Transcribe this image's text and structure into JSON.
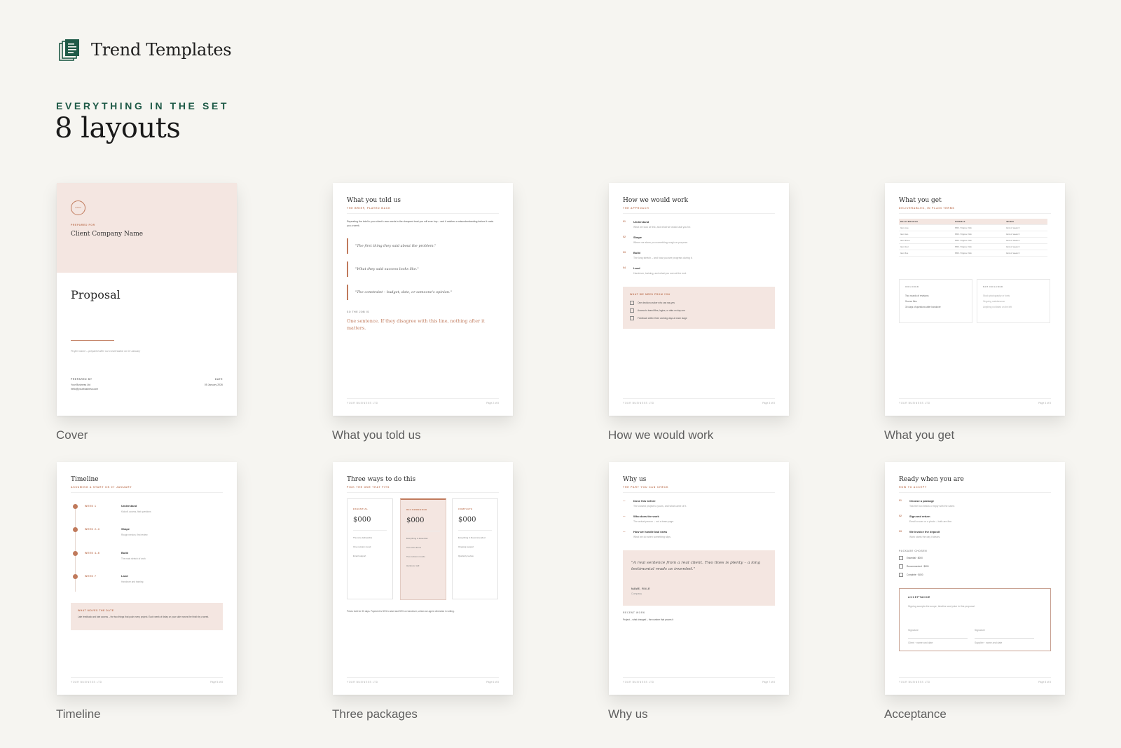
{
  "brand": {
    "name": "Trend Templates",
    "icon": "stacked-document-icon",
    "color": "#1f5a47"
  },
  "section": {
    "eyebrow": "EVERYTHING IN THE SET",
    "title": "8 layouts"
  },
  "colors": {
    "accent": "#c07a5c",
    "blush": "#f4e6e1",
    "brand_green": "#1f5a47",
    "background": "#f6f5f1"
  },
  "layouts": [
    {
      "caption": "Cover",
      "prepared_for_label": "PREPARED FOR",
      "client": "Client Company Name",
      "logo_text": "LOGO",
      "title": "Proposal",
      "project_line": "Project name – prepared after our conversation on 03 January",
      "prepared_by_label": "PREPARED BY",
      "business": "Your Business Ltd",
      "email": "hello@yourbusiness.com",
      "date_label": "DATE",
      "date": "05 January 2026"
    },
    {
      "caption": "What you told us",
      "title": "What you told us",
      "subtitle": "THE BRIEF, PLAYED BACK",
      "intro": "Repeating the brief in your client's own words is the cheapest trust you will ever buy – and it catches a misunderstanding before it costs you a week.",
      "quotes": [
        "\"The first thing they said about the problem.\"",
        "\"What they said success looks like.\"",
        "\"The constraint – budget, date, or someone's opinion.\""
      ],
      "job_label": "SO THE JOB IS",
      "job": "One sentence. If they disagree with this line, nothing after it matters.",
      "footer_left": "YOUR BUSINESS LTD",
      "footer_right": "Page 2 of 8"
    },
    {
      "caption": "How we would work",
      "title": "How we would work",
      "subtitle": "THE APPROACH",
      "steps": [
        {
          "num": "01",
          "name": "Understand",
          "desc": "What we look at first, and what we would ask you for."
        },
        {
          "num": "02",
          "name": "Shape",
          "desc": "Where we show you something rough on purpose."
        },
        {
          "num": "03",
          "name": "Build",
          "desc": "The long stretch – and how you see progress during it."
        },
        {
          "num": "04",
          "name": "Land",
          "desc": "Handover, training, and what you own at the end."
        }
      ],
      "needs_label": "WHAT WE NEED FROM YOU",
      "needs": [
        "One decision-maker who can say yes",
        "Access to brand files, logins, or data on day one",
        "Feedback within three working days at each stage"
      ],
      "footer_left": "YOUR BUSINESS LTD",
      "footer_right": "Page 3 of 8"
    },
    {
      "caption": "What you get",
      "title": "What you get",
      "subtitle": "DELIVERABLES, IN PLAIN TERMS",
      "columns": [
        "DELIVERABLE",
        "FORMAT",
        "WHEN"
      ],
      "rows": [
        [
          "Item one",
          "PDF / Figma / link",
          "End of week 0"
        ],
        [
          "Item two",
          "PDF / Figma / link",
          "End of week 0"
        ],
        [
          "Item three",
          "PDF / Figma / link",
          "End of week 0"
        ],
        [
          "Item four",
          "PDF / Figma / link",
          "End of week 0"
        ],
        [
          "Item five",
          "PDF / Figma / link",
          "End of week 0"
        ]
      ],
      "included_label": "INCLUDED",
      "included": [
        "Two rounds of revisions",
        "Source files",
        "30 days of questions after handover"
      ],
      "not_included_label": "NOT INCLUDED",
      "not_included": [
        "Stock photography or fonts",
        "Ongoing maintenance",
        "Anything not listed on the left"
      ],
      "footer_left": "YOUR BUSINESS LTD",
      "footer_right": "Page 4 of 8"
    },
    {
      "caption": "Timeline",
      "title": "Timeline",
      "subtitle": "ASSUMING A START ON 07 JANUARY",
      "weeks": [
        {
          "week": "WEEK 1",
          "name": "Understand",
          "desc": "Kickoff, access, first questions"
        },
        {
          "week": "WEEK 2–3",
          "name": "Shape",
          "desc": "Rough version, first review"
        },
        {
          "week": "WEEK 4–6",
          "name": "Build",
          "desc": "The main stretch of work"
        },
        {
          "week": "WEEK 7",
          "name": "Land",
          "desc": "Handover and training"
        }
      ],
      "moves_label": "WHAT MOVES THE DATE",
      "moves": "Late feedback and late access – the two things that push every project. Each week of delay on your side moves the finish by a week.",
      "footer_left": "YOUR BUSINESS LTD",
      "footer_right": "Page 5 of 8"
    },
    {
      "caption": "Three packages",
      "title": "Three ways to do this",
      "subtitle": "PICK THE ONE THAT FITS",
      "packages": [
        {
          "name": "ESSENTIAL",
          "price": "$000",
          "features": [
            "The core deliverable",
            "One revision round",
            "Email support"
          ]
        },
        {
          "name": "RECOMMENDED",
          "price": "$000",
          "features": [
            "Everything in Essential",
            "Two extra items",
            "Two revision rounds",
            "Handover call"
          ]
        },
        {
          "name": "COMPLETE",
          "price": "$000",
          "features": [
            "Everything in Recommended",
            "Ongoing support",
            "Quarterly review"
          ]
        }
      ],
      "note": "Prices hold for 30 days. Payment is 50% to start and 50% on handover, unless we agree otherwise in writing.",
      "footer_left": "YOUR BUSINESS LTD",
      "footer_right": "Page 6 of 8"
    },
    {
      "caption": "Why us",
      "title": "Why us",
      "subtitle": "THE PART YOU CAN CHECK",
      "points": [
        {
          "name": "Done this before",
          "desc": "The closest project to yours, and what came of it."
        },
        {
          "name": "Who does the work",
          "desc": "The actual person – not a team page."
        },
        {
          "name": "How we handle bad news",
          "desc": "What we do when something slips."
        }
      ],
      "testimonial": "\"A real sentence from a real client. Two lines is plenty – a long testimonial reads as invented.\"",
      "testimonial_name": "NAME, ROLE",
      "testimonial_company": "Company",
      "recent_label": "RECENT WORK",
      "recent": "Project – what changed – the number that proves it",
      "footer_left": "YOUR BUSINESS LTD",
      "footer_right": "Page 7 of 8"
    },
    {
      "caption": "Acceptance",
      "title": "Ready when you are",
      "subtitle": "HOW TO ACCEPT",
      "steps": [
        {
          "num": "01",
          "name": "Choose a package",
          "desc": "Tick the box below or reply with the name."
        },
        {
          "num": "02",
          "name": "Sign and return",
          "desc": "Email a scan or a photo – both are fine."
        },
        {
          "num": "03",
          "name": "We invoice the deposit",
          "desc": "Work starts the day it clears."
        }
      ],
      "choice_label": "PACKAGE CHOSEN",
      "choices": [
        "Essential · $000",
        "Recommended · $000",
        "Complete · $000"
      ],
      "acceptance_label": "ACCEPTANCE",
      "acceptance_text": "Signing accepts the scope, timeline and price in this proposal.",
      "sig_left": "Signature",
      "sig_right": "Signature",
      "name_left": "Client · name and date",
      "name_right": "Supplier · name and date",
      "footer_left": "YOUR BUSINESS LTD",
      "footer_right": "Page 8 of 8"
    }
  ]
}
